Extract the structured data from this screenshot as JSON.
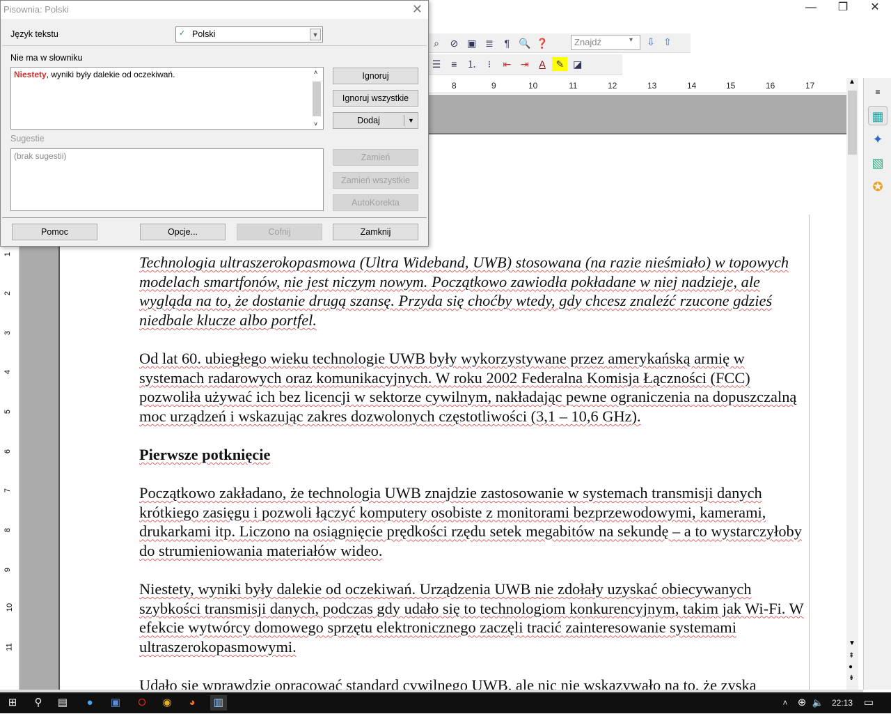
{
  "window": {
    "minimize": "—",
    "restore": "❐",
    "close": "✕"
  },
  "toolbar": {
    "find_placeholder": "Znajdź",
    "find_down": "⇩",
    "find_up": "⇧"
  },
  "ruler": {
    "h": [
      "8",
      "9",
      "10",
      "11",
      "12",
      "13",
      "14",
      "15",
      "16",
      "17"
    ],
    "v": [
      "1",
      "2",
      "3",
      "4",
      "5",
      "6",
      "7",
      "8",
      "9",
      "10",
      "11"
    ]
  },
  "document": {
    "p1": "Technologia ultraszerokopasmowa (Ultra Wideband, UWB) stosowana (na razie nieśmiało) w topowych modelach smartfonów, nie jest niczym nowym. Początkowo zawiodła pokładane w niej nadzieje, ale wygląda na to, że dostanie drugą szansę. Przyda się choćby wtedy, gdy chcesz znaleźć rzucone gdzieś niedbale klucze albo portfel.",
    "p2": "Od lat 60. ubiegłego wieku technologie UWB były wykorzystywane przez amerykańską armię w systemach radarowych oraz komunikacyjnych. W roku 2002 Federalna Komisja Łączności (FCC) pozwoliła używać ich bez licencji w sektorze cywilnym, nakładając pewne ograniczenia na dopuszczalną moc urządzeń i wskazując zakres dozwolonych częstotliwości (3,1 – 10,6 GHz).",
    "h1": "Pierwsze potknięcie",
    "p3": "Początkowo zakładano, że technologia UWB znajdzie zastosowanie w systemach transmisji danych krótkiego zasięgu i pozwoli łączyć komputery osobiste z monitorami bezprzewodowymi, kamerami, drukarkami itp. Liczono na osiągnięcie prędkości rzędu setek megabitów na sekundę – a to wystarczyłoby do strumieniowania materiałów wideo.",
    "p4": "Niestety, wyniki były dalekie od oczekiwań. Urządzenia UWB nie zdołały uzyskać obiecywanych szybkości transmisji danych, podczas gdy udało się to technologiom konkurencyjnym, takim jak Wi-Fi. W efekcie wytwórcy domowego sprzętu elektronicznego zaczęli tracić zainteresowanie systemami ultraszerokopasmowymi.",
    "p5": "Udało się wprawdzie opracować standard cywilnego UWB, ale nic nie wskazywało na to, że zyska"
  },
  "dialog": {
    "title": "Pisownia: Polski",
    "language_label": "Język tekstu",
    "language_value": "Polski",
    "not_in_dict_label": "Nie ma w słowniku",
    "error_word": "Niestety",
    "error_rest": ", wyniki były dalekie od oczekiwań.",
    "suggestions_label": "Sugestie",
    "suggestions_empty": "(brak sugestii)",
    "ignore": "Ignoruj",
    "ignore_all": "Ignoruj wszystkie",
    "add": "Dodaj",
    "replace": "Zamień",
    "replace_all": "Zamień wszystkie",
    "autocorrect": "AutoKorekta",
    "help": "Pomoc",
    "options": "Opcje...",
    "undo": "Cofnij",
    "close": "Zamknij"
  },
  "taskbar": {
    "time": "22:13"
  },
  "colors": {
    "error": "#d32f2f",
    "taskbar": "#101010"
  }
}
